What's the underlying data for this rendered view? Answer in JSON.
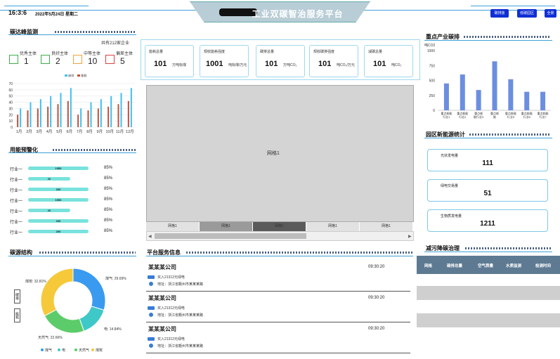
{
  "header": {
    "time": "16:3:6",
    "date": "2022年5月24日  星期二",
    "title": "工业双碳智治服务平台",
    "buttons": [
      "碳排放",
      "低碳园区",
      "全景"
    ]
  },
  "left": {
    "peak": {
      "title": "碳达峰监测",
      "enterprise_count": "共有212家企业",
      "categories": [
        {
          "label": "优秀主体",
          "value": "1",
          "color": "#3fae49"
        },
        {
          "label": "良好主体",
          "value": "2",
          "color": "#3fae49"
        },
        {
          "label": "中等主体",
          "value": "10",
          "color": "#f2a23a"
        },
        {
          "label": "偏差主体",
          "value": "5",
          "color": "#e04040"
        }
      ],
      "legend": [
        "碳排",
        "能耗"
      ]
    },
    "warning": {
      "title": "用能预警化",
      "rows": [
        {
          "label": "行业一",
          "value": "1550",
          "pct": "85%"
        },
        {
          "label": "行业一",
          "value": "20",
          "pct": "85%"
        },
        {
          "label": "行业一",
          "value": "200",
          "pct": "85%"
        },
        {
          "label": "行业一",
          "value": "1550",
          "pct": "85%"
        },
        {
          "label": "行业一",
          "value": "20",
          "pct": "85%"
        },
        {
          "label": "行业一",
          "value": "200",
          "pct": "85%"
        },
        {
          "label": "行业一",
          "value": "200",
          "pct": "85%"
        }
      ]
    },
    "structure": {
      "title": "碳源结构",
      "side_buttons": [
        "碳排",
        "能耗"
      ]
    }
  },
  "center": {
    "stats": [
      {
        "label": "能耗总量",
        "value": "101",
        "unit": "万吨标煤"
      },
      {
        "label": "规收能耗强度",
        "value": "1001",
        "unit": "吨标煤/万元"
      },
      {
        "label": "碳排总量",
        "value": "101",
        "unit": "万吨CO₂"
      },
      {
        "label": "规收碳排强度",
        "value": "101",
        "unit": "吨CO₂/万元"
      },
      {
        "label": "减碳总量",
        "value": "101",
        "unit": "吨CO₂"
      }
    ],
    "grid_label": "网格1",
    "tabs": [
      "网格1",
      "网格1",
      "网格1",
      "网格1",
      "网格1"
    ],
    "service": {
      "title": "平台服务信息",
      "items": [
        {
          "name": "某某某公司",
          "time": "09:30:20",
          "detail": "买入21312元绿电",
          "address": "地址：浙江省衢州市某某某路"
        },
        {
          "name": "某某某公司",
          "time": "09:30:20",
          "detail": "买入21312元绿电",
          "address": "地址：浙江省衢州市某某某路"
        },
        {
          "name": "某某某公司",
          "time": "09:30:20",
          "detail": "买入21312元绿电",
          "address": "地址：浙江省衢州市某某某路"
        }
      ]
    }
  },
  "right": {
    "industry": {
      "title": "重点产业碳排"
    },
    "newenergy": {
      "title": "园区新能源统计",
      "items": [
        {
          "label": "光伏发电量",
          "value": "111"
        },
        {
          "label": "绿电交易量",
          "value": "51"
        },
        {
          "label": "生物质发电量",
          "value": "1211"
        }
      ]
    },
    "pollution": {
      "title": "减污降碳治理",
      "columns": [
        "网格",
        "碳排总量",
        "空气质量",
        "水质监测",
        "检测时间"
      ]
    }
  },
  "chart_data": [
    {
      "type": "bar",
      "title": "",
      "categories": [
        "1月",
        "2月",
        "3月",
        "4月",
        "5月",
        "6月",
        "7月",
        "8月",
        "9月",
        "10月",
        "11月",
        "12月"
      ],
      "series": [
        {
          "name": "碳排",
          "color": "#3ec0f0",
          "values": [
            30,
            40,
            45,
            50,
            55,
            63,
            30,
            40,
            45,
            50,
            55,
            63
          ]
        },
        {
          "name": "能耗",
          "color": "#c0503a",
          "values": [
            20,
            27,
            30,
            33,
            37,
            42,
            20,
            27,
            30,
            33,
            37,
            42
          ]
        }
      ],
      "ylim": [
        0,
        70
      ],
      "yticks": [
        0,
        10,
        20,
        30,
        40,
        50,
        60,
        70
      ]
    },
    {
      "type": "pie",
      "slices": [
        {
          "name": "煤气",
          "value": 29.69,
          "label": "煤气: 29.69%",
          "color": "#3a9af0"
        },
        {
          "name": "电",
          "value": 14.84,
          "label": "电: 14.84%",
          "color": "#3ec8c8"
        },
        {
          "name": "天然气",
          "value": 22.66,
          "label": "天然气: 22.66%",
          "color": "#5ccc6a"
        },
        {
          "name": "煤炭",
          "value": 32.81,
          "label": "煤炭: 32.81%",
          "color": "#f5c93a"
        }
      ]
    },
    {
      "type": "bar",
      "ylabel": "吨CO2",
      "ylim": [
        0,
        1000
      ],
      "yticks": [
        0,
        250,
        500,
        750,
        1000
      ],
      "categories": [
        "重点耗能行业1",
        "重点耗能行业2",
        "重点耗能行业3",
        "重点耗能行业4",
        "重点耗能行业5",
        "重点耗能行业6",
        "重点耗能行业7"
      ],
      "tick_labels": [
        "重点耗能\n行业1",
        "重点耗能\n行业2",
        "重点耗\n能行业3",
        "重点耗\n能",
        "重点耗能\n行业5",
        "重点耗能\n行业6",
        "重点耗能\n行业7"
      ],
      "values": [
        450,
        600,
        340,
        820,
        520,
        310,
        310
      ],
      "color": "#6c8ee0"
    }
  ]
}
